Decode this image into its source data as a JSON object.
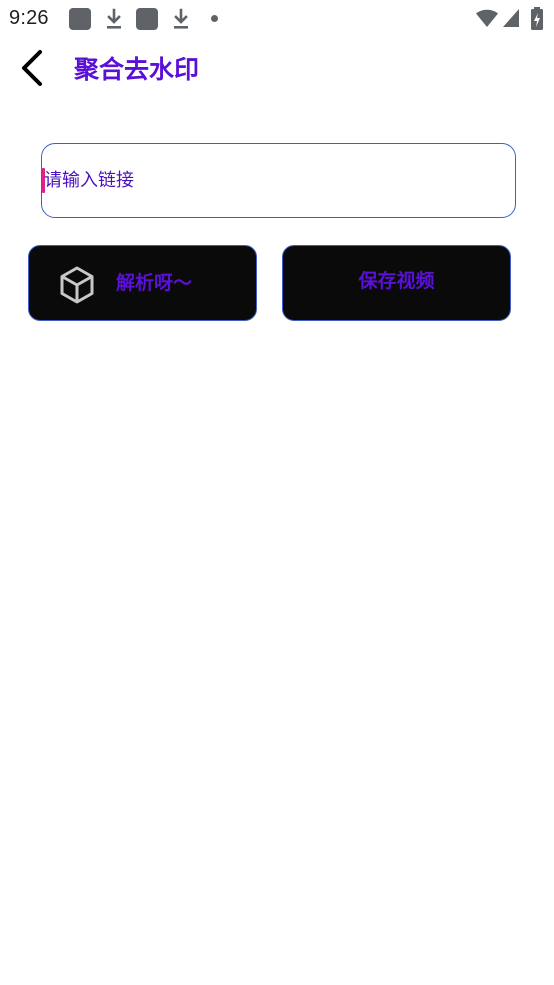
{
  "status_bar": {
    "time": "9:26",
    "icons": [
      "app-notification-icon",
      "download-icon",
      "app-notification-icon",
      "download-icon",
      "more-notifications-dot-icon",
      "wifi-icon",
      "signal-icon",
      "battery-charging-icon"
    ]
  },
  "app_bar": {
    "back_icon": "chevron-left-icon",
    "title": "聚合去水印"
  },
  "link_input": {
    "value": "",
    "placeholder": "请输入链接"
  },
  "actions": {
    "parse": {
      "icon": "cube-icon",
      "label": "解析呀～"
    },
    "save": {
      "label": "保存视频"
    }
  },
  "colors": {
    "accent": "#5a10d6",
    "border": "#3f5ec8",
    "button_bg": "#0a0a0a",
    "caret": "#e0218a",
    "background": "#ffffff"
  }
}
